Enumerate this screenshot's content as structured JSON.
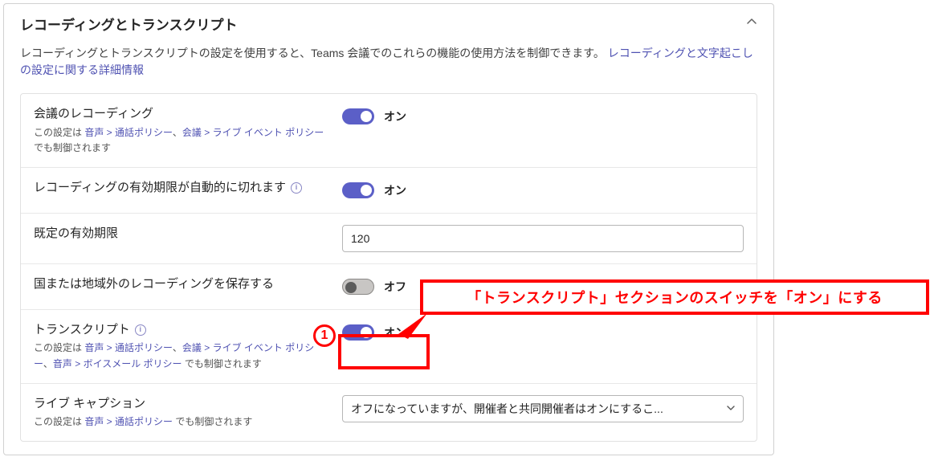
{
  "panel": {
    "title": "レコーディングとトランスクリプト",
    "desc_prefix": "レコーディングとトランスクリプトの設定を使用すると、Teams 会議でのこれらの機能の使用方法を制御できます。",
    "desc_link": "レコーディングと文字起こしの設定に関する詳細情報"
  },
  "rows": {
    "r1": {
      "title": "会議のレコーディング",
      "sub_prefix": "この設定は ",
      "link1": "音声 > 通話ポリシー",
      "sep": "、",
      "link2": "会議 > ライブ イベント ポリシー",
      "sub_suffix": " でも制御されます",
      "state": "オン"
    },
    "r2": {
      "title": "レコーディングの有効期限が自動的に切れます",
      "state": "オン"
    },
    "r3": {
      "title": "既定の有効期限",
      "value": "120"
    },
    "r4": {
      "title": "国または地域外のレコーディングを保存する",
      "state": "オフ"
    },
    "r5": {
      "title": "トランスクリプト",
      "sub_prefix": "この設定は ",
      "link1": "音声 > 通話ポリシー",
      "sep1": "、",
      "link2": "会議 > ライブ イベント ポリシー",
      "sep2": "、",
      "link3": "音声 > ボイスメール ポリシー",
      "sub_suffix": " でも制御されます",
      "state": "オン"
    },
    "r6": {
      "title": "ライブ キャプション",
      "sub_prefix": "この設定は ",
      "link1": "音声 > 通話ポリシー",
      "sub_suffix": " でも制御されます",
      "selected": "オフになっていますが、開催者と共同開催者はオンにするこ..."
    }
  },
  "annotation": {
    "callout": "「トランスクリプト」セクションのスイッチを「オン」にする",
    "badge": "1"
  }
}
